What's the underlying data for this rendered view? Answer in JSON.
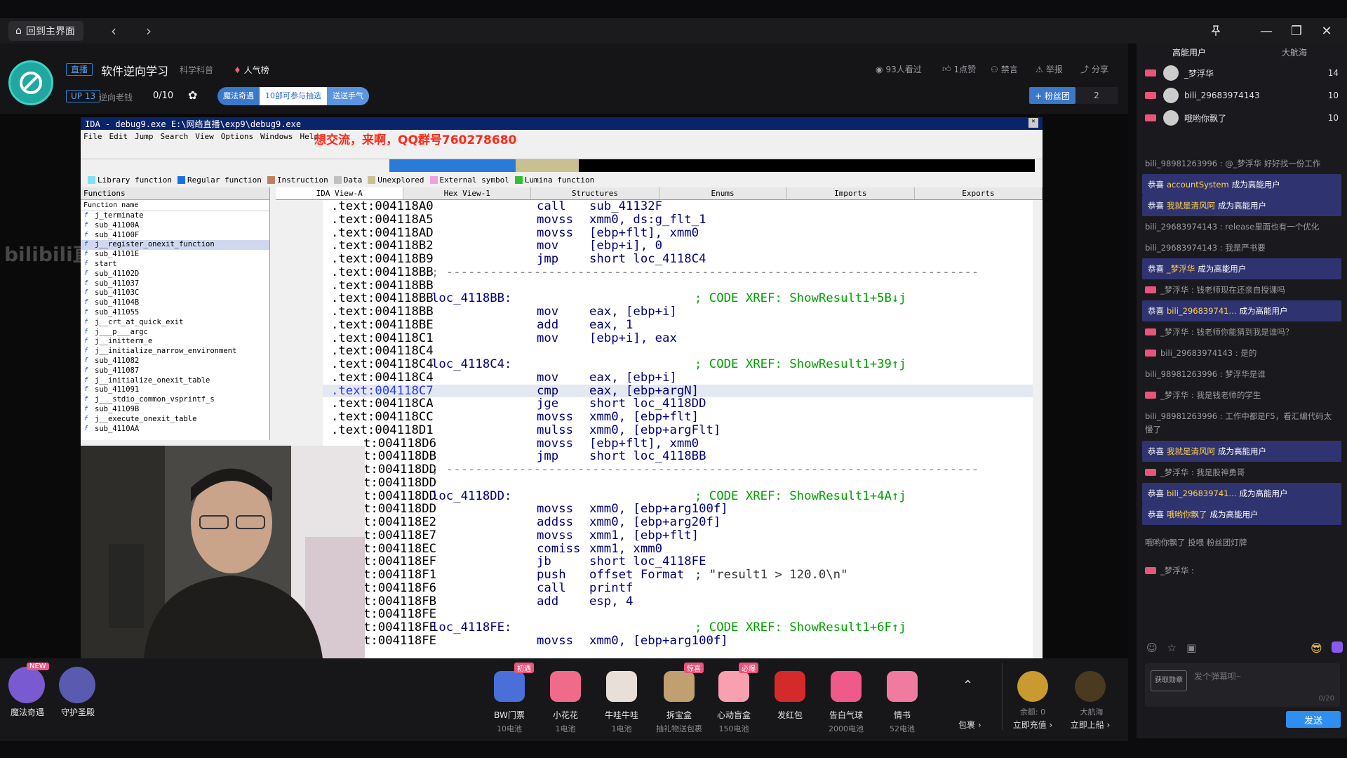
{
  "topbar": {
    "home_label": "回到主界面"
  },
  "header": {
    "live_tag": "直播",
    "title": "软件逆向学习",
    "category": "科学科普",
    "popular": "人气榜",
    "up_level": "UP 13",
    "up_name": "逆向老钱",
    "progress_text": "0/10",
    "pill": [
      "魔法奇遇",
      "10部可参与抽选",
      "送送手气"
    ],
    "viewers": "93人看过",
    "likes": "1点赞",
    "ban": "禁言",
    "report": "举报",
    "share": "分享",
    "fans_label": "+ 粉丝团",
    "fans_count": "2"
  },
  "ida": {
    "title": "IDA - debug9.exe E:\\网络直播\\exp9\\debug9.exe",
    "promo": "想交流，来啊，QQ群号760278680",
    "menu": [
      "File",
      "Edit",
      "Jump",
      "Search",
      "View",
      "Options",
      "Windows",
      "Help"
    ],
    "legend": [
      "Library function",
      "Regular function",
      "Instruction",
      "Data",
      "Unexplored",
      "External symbol",
      "Lumina function"
    ],
    "functions_title": "Functions",
    "functions_col": "Function name",
    "functions": [
      "j_terminate",
      "sub_41100A",
      "sub_41100F",
      "j__register_onexit_function",
      "sub_41101E",
      "start",
      "sub_41102D",
      "sub_411037",
      "sub_41103C",
      "sub_41104B",
      "sub_411055",
      "j__crt_at_quick_exit",
      "j___p___argc",
      "j__initterm_e",
      "j__initialize_narrow_environment",
      "sub_411082",
      "sub_411087",
      "j__initialize_onexit_table",
      "sub_411091",
      "j___stdio_common_vsprintf_s",
      "sub_41109B",
      "j__execute_onexit_table",
      "sub_4110AA"
    ],
    "tabs": [
      "IDA View-A",
      "Hex View-1",
      "Structures",
      "Enums",
      "Imports",
      "Exports"
    ],
    "code": [
      [
        ".text:004118A0",
        "",
        "call",
        "sub_41132F",
        ""
      ],
      [
        ".text:004118A5",
        "",
        "movss",
        "xmm0, ds:g_flt_1",
        ""
      ],
      [
        ".text:004118AD",
        "",
        "movss",
        "[ebp+flt], xmm0",
        ""
      ],
      [
        ".text:004118B2",
        "",
        "mov",
        "[ebp+i], 0",
        ""
      ],
      [
        ".text:004118B9",
        "",
        "jmp",
        "short loc_4118C4",
        ""
      ],
      [
        ".text:004118BB",
        "sep",
        "",
        "",
        ""
      ],
      [
        ".text:004118BB",
        "",
        "",
        "",
        ""
      ],
      [
        ".text:004118BB",
        "loc_4118BB:",
        "",
        "",
        "; CODE XREF: ShowResult1+5B↓j"
      ],
      [
        ".text:004118BB",
        "",
        "mov",
        "eax, [ebp+i]",
        ""
      ],
      [
        ".text:004118BE",
        "",
        "add",
        "eax, 1",
        ""
      ],
      [
        ".text:004118C1",
        "",
        "mov",
        "[ebp+i], eax",
        ""
      ],
      [
        ".text:004118C4",
        "",
        "",
        "",
        ""
      ],
      [
        ".text:004118C4",
        "loc_4118C4:",
        "",
        "",
        "; CODE XREF: ShowResult1+39↑j"
      ],
      [
        ".text:004118C4",
        "",
        "mov",
        "eax, [ebp+i]",
        ""
      ],
      [
        ".text:004118C7",
        "",
        "cmp",
        "eax, [ebp+argN]",
        ""
      ],
      [
        ".text:004118CA",
        "",
        "jge",
        "short loc_4118DD",
        ""
      ],
      [
        ".text:004118CC",
        "",
        "movss",
        "xmm0, [ebp+flt]",
        ""
      ],
      [
        ".text:004118D1",
        "",
        "mulss",
        "xmm0, [ebp+argFlt]",
        ""
      ],
      [
        "t:004118D6",
        "",
        "movss",
        "[ebp+flt], xmm0",
        ""
      ],
      [
        "t:004118DB",
        "",
        "jmp",
        "short loc_4118BB",
        ""
      ],
      [
        "t:004118DD",
        "sep",
        "",
        "",
        ""
      ],
      [
        "t:004118DD",
        "",
        "",
        "",
        ""
      ],
      [
        "t:004118DD",
        "loc_4118DD:",
        "",
        "",
        "; CODE XREF: ShowResult1+4A↑j"
      ],
      [
        "t:004118DD",
        "",
        "movss",
        "xmm0, [ebp+arg100f]",
        ""
      ],
      [
        "t:004118E2",
        "",
        "addss",
        "xmm0, [ebp+arg20f]",
        ""
      ],
      [
        "t:004118E7",
        "",
        "movss",
        "xmm1, [ebp+flt]",
        ""
      ],
      [
        "t:004118EC",
        "",
        "comiss",
        "xmm1, xmm0",
        ""
      ],
      [
        "t:004118EF",
        "",
        "jb",
        "short loc_4118FE",
        ""
      ],
      [
        "t:004118F1",
        "",
        "push",
        "offset Format",
        "; \"result1 > 120.0\\n\""
      ],
      [
        "t:004118F6",
        "",
        "call",
        "printf",
        ""
      ],
      [
        "t:004118FB",
        "",
        "add",
        "esp, 4",
        ""
      ],
      [
        "t:004118FE",
        "",
        "",
        "",
        ""
      ],
      [
        "t:004118FE",
        "loc_4118FE:",
        "",
        "",
        "; CODE XREF: ShowResult1+6F↑j"
      ],
      [
        "t:004118FE",
        "",
        "movss",
        "xmm0, [ebp+arg100f]",
        ""
      ]
    ]
  },
  "watermark": "bilibili直播",
  "gifts": [
    {
      "name": "BW门票",
      "price": "10电池",
      "badge": "初遇",
      "color": "#4a6fd8"
    },
    {
      "name": "小花花",
      "price": "1电池",
      "badge": "",
      "color": "#f06a8a"
    },
    {
      "name": "牛哇牛哇",
      "price": "1电池",
      "badge": "",
      "color": "#e8e0d8"
    },
    {
      "name": "拆宝盒",
      "price": "抽礼物送包裹",
      "badge": "惊喜",
      "color": "#c0a070"
    },
    {
      "name": "心动盲盒",
      "price": "150电池",
      "badge": "必爆",
      "color": "#f8a0b0"
    },
    {
      "name": "发红包",
      "price": "",
      "badge": "",
      "color": "#d42a2a"
    },
    {
      "name": "告白气球",
      "price": "2000电池",
      "badge": "",
      "color": "#f05a8a"
    },
    {
      "name": "情书",
      "price": "52电池",
      "badge": "",
      "color": "#f07aa0"
    }
  ],
  "side_icons": [
    {
      "name": "魔法奇遇",
      "badge": "NEW"
    },
    {
      "name": "守护圣殿",
      "badge": ""
    }
  ],
  "giftbar": {
    "package": "包裹 ›",
    "balance": "余额: 0",
    "recharge": "立即充值 ›",
    "fleet": "大航海",
    "board": "立即上船 ›"
  },
  "sidebar": {
    "tabs": [
      "高能用户",
      "大航海"
    ],
    "ranks": [
      {
        "name": "_梦浮华",
        "score": "14"
      },
      {
        "name": "bili_29683974143",
        "score": "10"
      },
      {
        "name": "哦哟你飘了",
        "score": "10"
      }
    ],
    "messages": [
      {
        "t": "n",
        "text": "bili_98981263996 : @_梦浮华 好好找一份工作"
      },
      {
        "t": "s",
        "pre": "恭喜",
        "u": "accountSystem",
        "post": "成为高能用户"
      },
      {
        "t": "s",
        "pre": "恭喜",
        "u": "我就是清风阿",
        "post": "成为高能用户"
      },
      {
        "t": "n",
        "text": "bili_29683974143 : release里面也有一个优化"
      },
      {
        "t": "n",
        "text": "bili_29683974143 : 我是严书要"
      },
      {
        "t": "s",
        "pre": "恭喜",
        "u": "_梦浮华",
        "post": "成为高能用户"
      },
      {
        "t": "l",
        "text": "_梦浮华 : 钱老师现在还亲自授课吗"
      },
      {
        "t": "s",
        "pre": "恭喜",
        "u": "bili_296839741...",
        "post": "成为高能用户"
      },
      {
        "t": "l",
        "text": "_梦浮华 : 钱老师你能猜到我是谁吗？"
      },
      {
        "t": "l",
        "text": "bili_29683974143 : 是的"
      },
      {
        "t": "n",
        "text": "bili_98981263996 : 梦浮华是谁"
      },
      {
        "t": "l",
        "text": "_梦浮华 : 我是钱老师的学生"
      },
      {
        "t": "tall",
        "text": "bili_98981263996 : 工作中都是F5，看汇编代码太慢了"
      },
      {
        "t": "s",
        "pre": "恭喜",
        "u": "我就是清风阿",
        "post": "成为高能用户"
      },
      {
        "t": "l",
        "text": "_梦浮华 : 我是股神勇哥"
      },
      {
        "t": "s",
        "pre": "恭喜",
        "u": "bili_296839741...",
        "post": "成为高能用户"
      },
      {
        "t": "s",
        "pre": "恭喜",
        "u": "哦哟你飘了",
        "post": "成为高能用户"
      },
      {
        "t": "tall",
        "text": "哦哟你飘了 投喂 粉丝团灯牌"
      },
      {
        "t": "l",
        "text": "_梦浮华 :"
      }
    ],
    "input_btn": "获取勋章",
    "input_placeholder": "发个弹幕呗~",
    "input_count": "0/20",
    "send": "发送"
  }
}
